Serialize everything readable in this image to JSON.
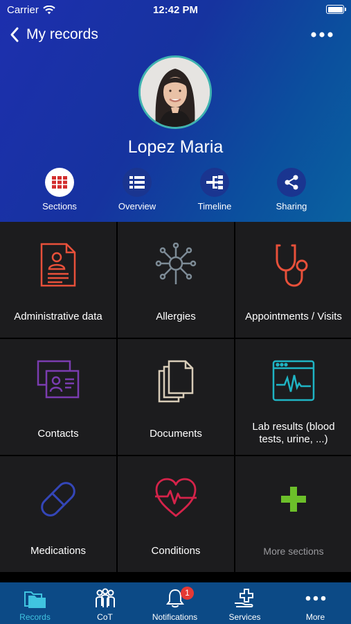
{
  "status_bar": {
    "carrier": "Carrier",
    "time": "12:42 PM"
  },
  "nav": {
    "back_title": "My records"
  },
  "profile": {
    "name": "Lopez Maria"
  },
  "view_tabs": [
    {
      "label": "Sections",
      "icon": "grid-icon",
      "active": true
    },
    {
      "label": "Overview",
      "icon": "list-icon",
      "active": false
    },
    {
      "label": "Timeline",
      "icon": "timeline-icon",
      "active": false
    },
    {
      "label": "Sharing",
      "icon": "share-icon",
      "active": false
    }
  ],
  "sections": [
    {
      "label": "Administrative data",
      "icon": "document-person-icon",
      "color": "#e8503a"
    },
    {
      "label": "Allergies",
      "icon": "allergen-icon",
      "color": "#7d8b96"
    },
    {
      "label": "Appointments / Visits",
      "icon": "stethoscope-icon",
      "color": "#e8503a"
    },
    {
      "label": "Contacts",
      "icon": "contact-cards-icon",
      "color": "#7a3cb0"
    },
    {
      "label": "Documents",
      "icon": "documents-icon",
      "color": "#d8ccb8"
    },
    {
      "label": "Lab results (blood tests, urine, ...)",
      "icon": "lab-monitor-icon",
      "color": "#1fb4c4"
    },
    {
      "label": "Medications",
      "icon": "pill-icon",
      "color": "#3446b8"
    },
    {
      "label": "Conditions",
      "icon": "heart-pulse-icon",
      "color": "#d5234a"
    },
    {
      "label": "More sections",
      "icon": "plus-icon",
      "color": "#6cbf2a"
    }
  ],
  "tab_bar": [
    {
      "label": "Records",
      "icon": "folders-icon",
      "active": true
    },
    {
      "label": "CoT",
      "icon": "group-icon",
      "active": false
    },
    {
      "label": "Notifications",
      "icon": "bell-icon",
      "active": false,
      "badge": "1"
    },
    {
      "label": "Services",
      "icon": "services-icon",
      "active": false
    },
    {
      "label": "More",
      "icon": "more-dots-icon",
      "active": false
    }
  ],
  "colors": {
    "accent": "#40c4e0",
    "header_start": "#1d2fae",
    "header_end": "#0a62a0",
    "tab_bar": "#0c4a86",
    "badge": "#e53935"
  }
}
